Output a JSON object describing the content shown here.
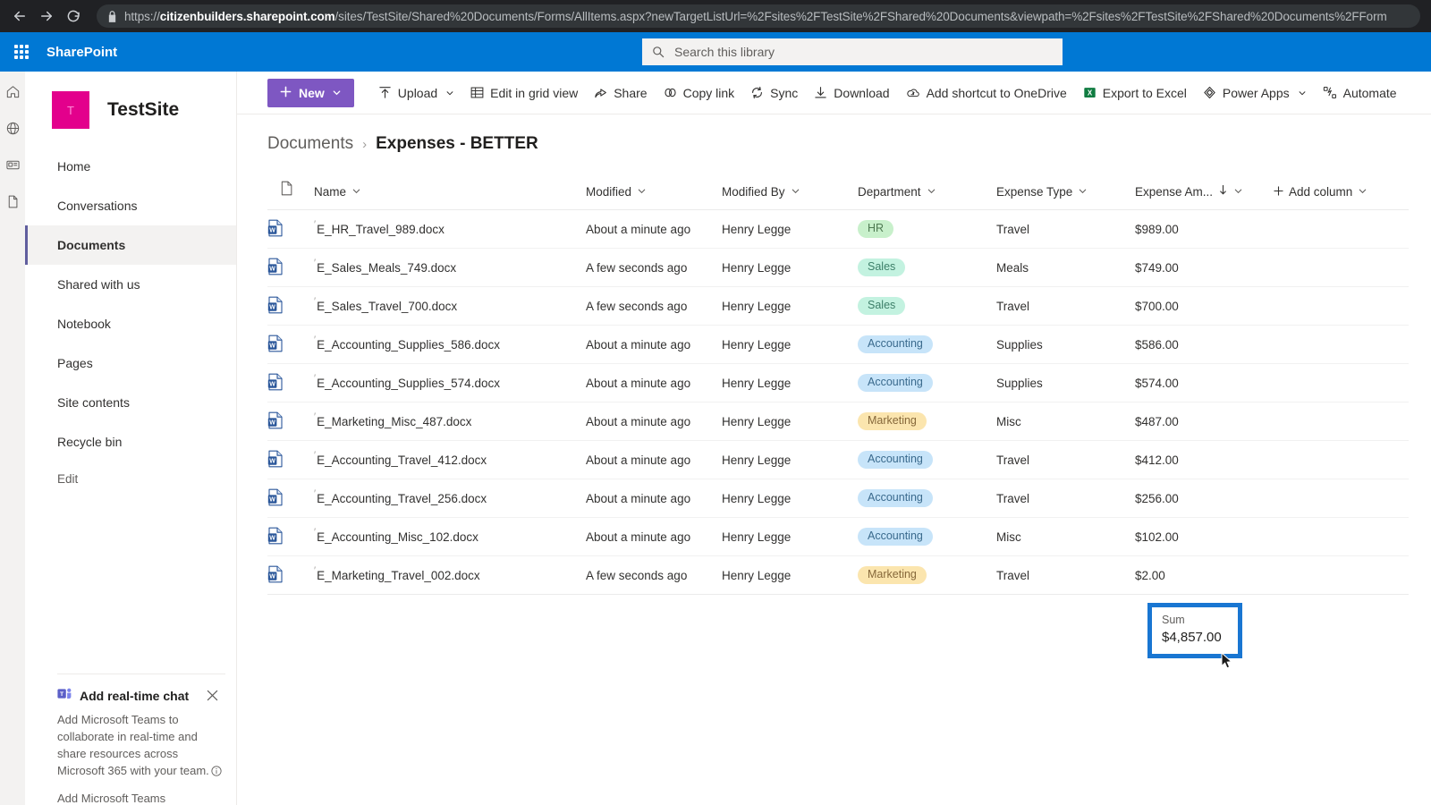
{
  "browser": {
    "back_icon": "arrow-left-icon",
    "forward_icon": "arrow-right-icon",
    "reload_icon": "reload-icon",
    "lock_icon": "lock-icon",
    "url_host": "citizenbuilders.sharepoint.com",
    "url_prefix": "https://",
    "url_path": "/sites/TestSite/Shared%20Documents/Forms/AllItems.aspx?newTargetListUrl=%2Fsites%2FTestSite%2FShared%20Documents&viewpath=%2Fsites%2FTestSite%2FShared%20Documents%2FForm"
  },
  "suite": {
    "waffle_icon": "app-launcher-icon",
    "brand": "SharePoint",
    "search_icon": "search-icon",
    "search_placeholder": "Search this library",
    "accent_color": "#0078d4"
  },
  "rail": {
    "items": [
      {
        "icon": "home-icon"
      },
      {
        "icon": "globe-icon"
      },
      {
        "icon": "news-icon"
      },
      {
        "icon": "document-icon"
      }
    ]
  },
  "site": {
    "logo_letter": "T",
    "logo_color": "#e3008c",
    "title": "TestSite",
    "nav": [
      {
        "label": "Home",
        "selected": false
      },
      {
        "label": "Conversations",
        "selected": false
      },
      {
        "label": "Documents",
        "selected": true
      },
      {
        "label": "Shared with us",
        "selected": false
      },
      {
        "label": "Notebook",
        "selected": false
      },
      {
        "label": "Pages",
        "selected": false
      },
      {
        "label": "Site contents",
        "selected": false
      },
      {
        "label": "Recycle bin",
        "selected": false
      },
      {
        "label": "Edit",
        "selected": false
      }
    ]
  },
  "promo": {
    "icon": "teams-icon",
    "close_icon": "close-icon",
    "title": "Add real-time chat",
    "body": "Add Microsoft Teams to collaborate in real-time and share resources across Microsoft 365 with your team.",
    "info_icon": "info-icon",
    "link": "Add Microsoft Teams"
  },
  "toolbar": {
    "new_label": "New",
    "new_icon": "plus-icon",
    "new_color": "#7e57c2",
    "items": [
      {
        "label": "Upload",
        "icon": "upload-icon",
        "has_chevron": true
      },
      {
        "label": "Edit in grid view",
        "icon": "grid-icon",
        "has_chevron": false
      },
      {
        "label": "Share",
        "icon": "share-icon",
        "has_chevron": false
      },
      {
        "label": "Copy link",
        "icon": "link-icon",
        "has_chevron": false
      },
      {
        "label": "Sync",
        "icon": "sync-icon",
        "has_chevron": false
      },
      {
        "label": "Download",
        "icon": "download-icon",
        "has_chevron": false
      },
      {
        "label": "Add shortcut to OneDrive",
        "icon": "onedrive-shortcut-icon",
        "has_chevron": false
      },
      {
        "label": "Export to Excel",
        "icon": "excel-icon",
        "has_chevron": false
      },
      {
        "label": "Power Apps",
        "icon": "power-apps-icon",
        "has_chevron": true
      },
      {
        "label": "Automate",
        "icon": "automate-icon",
        "has_chevron": false
      }
    ]
  },
  "breadcrumb": {
    "parent": "Documents",
    "separator": "›",
    "current": "Expenses - BETTER"
  },
  "table": {
    "columns": [
      {
        "label": "",
        "icon": "file-type-icon",
        "sortable": false
      },
      {
        "label": "Name",
        "sortable": true
      },
      {
        "label": "Modified",
        "sortable": true
      },
      {
        "label": "Modified By",
        "sortable": true
      },
      {
        "label": "Department",
        "sortable": true
      },
      {
        "label": "Expense Type",
        "sortable": true
      },
      {
        "label": "Expense Am...",
        "sortable": true,
        "sort_direction": "descending",
        "sort_icon": "arrow-down-icon"
      },
      {
        "label": "Add column",
        "icon": "plus-icon",
        "sortable": true
      }
    ],
    "rows": [
      {
        "icon": "word-doc-icon",
        "new_badge": "′",
        "name": "E_HR_Travel_989.docx",
        "modified": "About a minute ago",
        "modified_by": "Henry Legge",
        "department": "HR",
        "dept_class": "pill-hr",
        "expense_type": "Travel",
        "amount": "$989.00"
      },
      {
        "icon": "word-doc-icon",
        "new_badge": "′",
        "name": "E_Sales_Meals_749.docx",
        "modified": "A few seconds ago",
        "modified_by": "Henry Legge",
        "department": "Sales",
        "dept_class": "pill-sales",
        "expense_type": "Meals",
        "amount": "$749.00"
      },
      {
        "icon": "word-doc-icon",
        "new_badge": "′",
        "name": "E_Sales_Travel_700.docx",
        "modified": "A few seconds ago",
        "modified_by": "Henry Legge",
        "department": "Sales",
        "dept_class": "pill-sales",
        "expense_type": "Travel",
        "amount": "$700.00"
      },
      {
        "icon": "word-doc-icon",
        "new_badge": "′",
        "name": "E_Accounting_Supplies_586.docx",
        "modified": "About a minute ago",
        "modified_by": "Henry Legge",
        "department": "Accounting",
        "dept_class": "pill-accounting",
        "expense_type": "Supplies",
        "amount": "$586.00"
      },
      {
        "icon": "word-doc-icon",
        "new_badge": "′",
        "name": "E_Accounting_Supplies_574.docx",
        "modified": "About a minute ago",
        "modified_by": "Henry Legge",
        "department": "Accounting",
        "dept_class": "pill-accounting",
        "expense_type": "Supplies",
        "amount": "$574.00"
      },
      {
        "icon": "word-doc-icon",
        "new_badge": "′",
        "name": "E_Marketing_Misc_487.docx",
        "modified": "About a minute ago",
        "modified_by": "Henry Legge",
        "department": "Marketing",
        "dept_class": "pill-marketing",
        "expense_type": "Misc",
        "amount": "$487.00"
      },
      {
        "icon": "word-doc-icon",
        "new_badge": "′",
        "name": "E_Accounting_Travel_412.docx",
        "modified": "About a minute ago",
        "modified_by": "Henry Legge",
        "department": "Accounting",
        "dept_class": "pill-accounting",
        "expense_type": "Travel",
        "amount": "$412.00"
      },
      {
        "icon": "word-doc-icon",
        "new_badge": "′",
        "name": "E_Accounting_Travel_256.docx",
        "modified": "About a minute ago",
        "modified_by": "Henry Legge",
        "department": "Accounting",
        "dept_class": "pill-accounting",
        "expense_type": "Travel",
        "amount": "$256.00"
      },
      {
        "icon": "word-doc-icon",
        "new_badge": "′",
        "name": "E_Accounting_Misc_102.docx",
        "modified": "About a minute ago",
        "modified_by": "Henry Legge",
        "department": "Accounting",
        "dept_class": "pill-accounting",
        "expense_type": "Misc",
        "amount": "$102.00"
      },
      {
        "icon": "word-doc-icon",
        "new_badge": "′",
        "name": "E_Marketing_Travel_002.docx",
        "modified": "A few seconds ago",
        "modified_by": "Henry Legge",
        "department": "Marketing",
        "dept_class": "pill-marketing",
        "expense_type": "Travel",
        "amount": "$2.00"
      }
    ]
  },
  "summary": {
    "label": "Sum",
    "value": "$4,857.00",
    "highlight_color": "#1976d2"
  }
}
